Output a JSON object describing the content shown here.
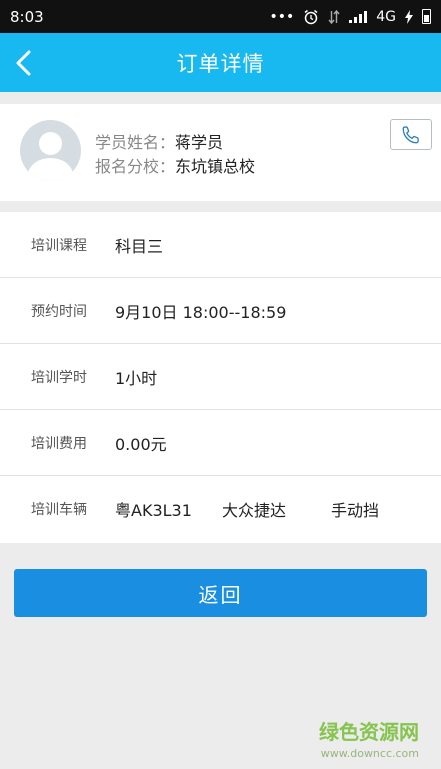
{
  "status_bar": {
    "time": "8:03",
    "dots": "•••",
    "network": "4G",
    "icons": [
      "alarm-icon",
      "data-arrows-icon",
      "signal-icon",
      "charging-icon",
      "battery-icon"
    ]
  },
  "header": {
    "title": "订单详情",
    "background": "#18b8f0",
    "back_icon": "chevron-left-icon"
  },
  "profile": {
    "name_label": "学员姓名：",
    "name_value": "蒋学员",
    "school_label": "报名分校：",
    "school_value": "东坑镇总校",
    "call_icon": "phone-icon"
  },
  "details": [
    {
      "label": "培训课程",
      "value": "科目三"
    },
    {
      "label": "预约时间",
      "value": "9月10日 18:00--18:59"
    },
    {
      "label": "培训学时",
      "value": "1小时"
    },
    {
      "label": "培训费用",
      "value": "0.00元"
    },
    {
      "label": "培训车辆",
      "value": "粤AK3L31",
      "value2": "大众捷达",
      "value3": "手动挡"
    }
  ],
  "return_button": {
    "label": "返回",
    "color": "#1a8ee0"
  },
  "watermark": {
    "title": "绿色资源网",
    "url": "www.downcc.com"
  }
}
